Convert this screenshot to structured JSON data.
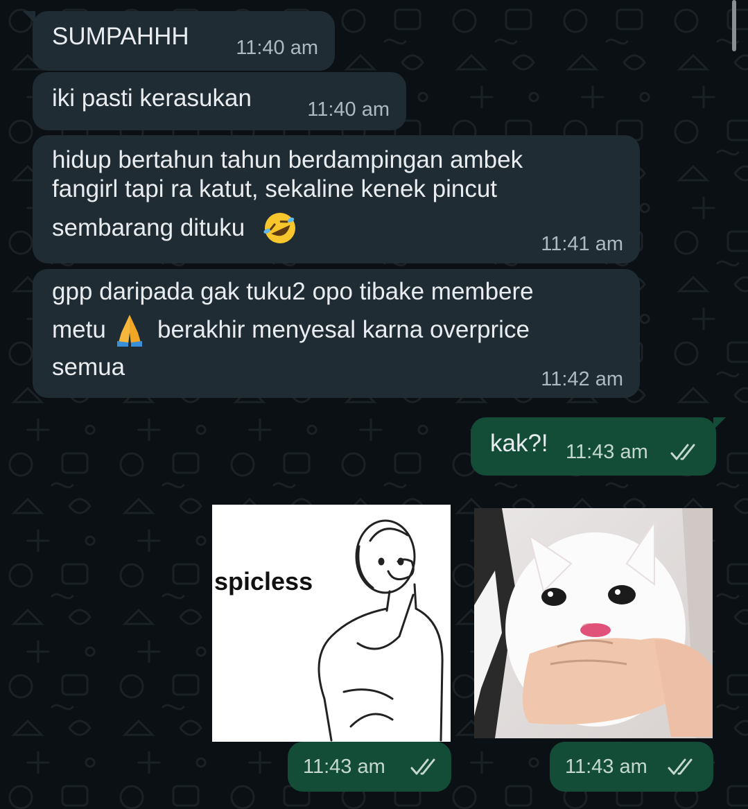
{
  "messages": [
    {
      "id": "m1",
      "direction": "incoming",
      "lines": [
        "SUMPAHHH"
      ],
      "time": "11:40 am"
    },
    {
      "id": "m2",
      "direction": "incoming",
      "lines": [
        "iki pasti kerasukan"
      ],
      "time": "11:40 am"
    },
    {
      "id": "m3",
      "direction": "incoming",
      "lines": [
        "hidup bertahun tahun berdampingan ambek",
        "fangirl tapi ra katut, sekaline kenek pincut",
        "sembarang dituku"
      ],
      "emoji": "rolling-on-floor-laughing",
      "time": "11:41 am"
    },
    {
      "id": "m4",
      "direction": "incoming",
      "lines": [
        "gpp daripada gak tuku2 opo tibake membere",
        "metu",
        "berakhir menyesal karna overprice",
        "semua"
      ],
      "emoji": "folded-hands",
      "time": "11:42 am"
    },
    {
      "id": "m5",
      "direction": "outgoing",
      "lines": [
        "kak?!"
      ],
      "time": "11:43 am",
      "status": "read"
    },
    {
      "id": "m6",
      "direction": "outgoing",
      "type": "sticker",
      "caption": "spicless",
      "time": "11:43 am",
      "status": "read"
    },
    {
      "id": "m7",
      "direction": "outgoing",
      "type": "image",
      "subject": "crying white cat with mouth covered by hand",
      "time": "11:43 am",
      "status": "read"
    }
  ],
  "colors": {
    "background": "#0b1014",
    "incoming_bubble": "#1f2c33",
    "outgoing_bubble": "#144d37",
    "text": "#e9edef",
    "meta": "#aebac1",
    "read_ticks": "#c5d8cf"
  }
}
